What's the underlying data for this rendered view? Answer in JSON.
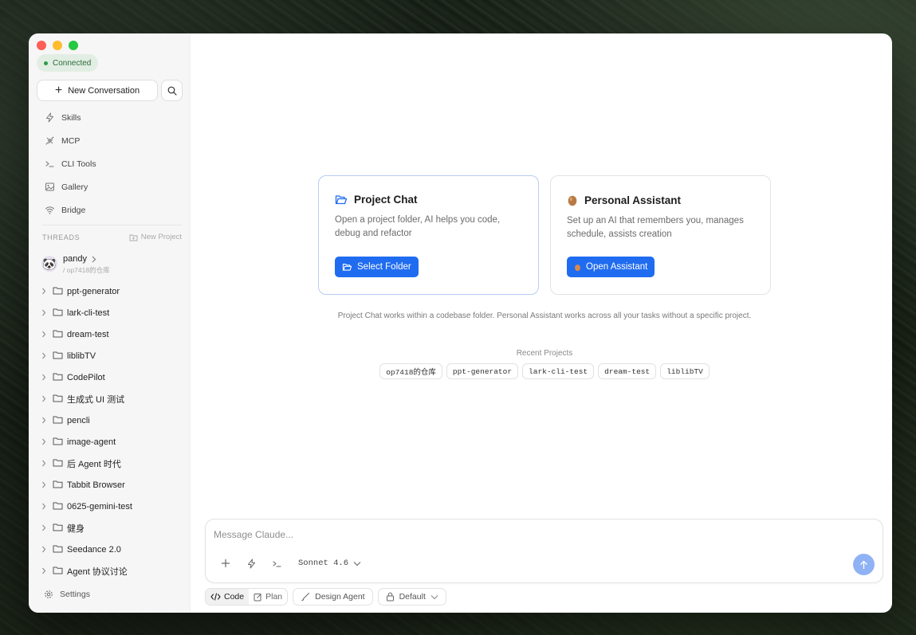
{
  "status": {
    "label": "Connected",
    "color": "#2f9a49"
  },
  "sidebar": {
    "new_conversation": "New Conversation",
    "nav": [
      {
        "label": "Skills",
        "icon": "bolt-icon"
      },
      {
        "label": "MCP",
        "icon": "plug-icon"
      },
      {
        "label": "CLI Tools",
        "icon": "terminal-icon"
      },
      {
        "label": "Gallery",
        "icon": "image-icon"
      },
      {
        "label": "Bridge",
        "icon": "wifi-icon"
      }
    ],
    "threads_label": "THREADS",
    "new_project": "New Project",
    "user": {
      "name": "pandy",
      "path": "/ op7418的仓库",
      "avatar": "🐼"
    },
    "folders": [
      "ppt-generator",
      "lark-cli-test",
      "dream-test",
      "liblibTV",
      "CodePilot",
      "生成式 UI 测试",
      "pencli",
      "image-agent",
      "后 Agent 时代",
      "Tabbit Browser",
      "0625-gemini-test",
      "健身",
      "Seedance 2.0",
      "Agent 协议讨论"
    ],
    "settings": "Settings"
  },
  "cards": {
    "project": {
      "title": "Project Chat",
      "desc": "Open a project folder, AI helps you code, debug and refactor",
      "button": "Select Folder"
    },
    "personal": {
      "title": "Personal Assistant",
      "desc": "Set up an AI that remembers you, manages schedule, assists creation",
      "button": "Open Assistant"
    }
  },
  "caption": "Project Chat works within a codebase folder. Personal Assistant works across all your tasks without a specific project.",
  "recent": {
    "label": "Recent Projects",
    "items": [
      "op7418的仓库",
      "ppt-generator",
      "lark-cli-test",
      "dream-test",
      "liblibTV"
    ]
  },
  "composer": {
    "placeholder": "Message Claude...",
    "model": "Sonnet 4.6"
  },
  "modes": {
    "code": "Code",
    "plan": "Plan",
    "design_agent": "Design Agent",
    "permission": "Default"
  },
  "colors": {
    "accent": "#1f6cf0",
    "send": "#8fb2f5"
  }
}
